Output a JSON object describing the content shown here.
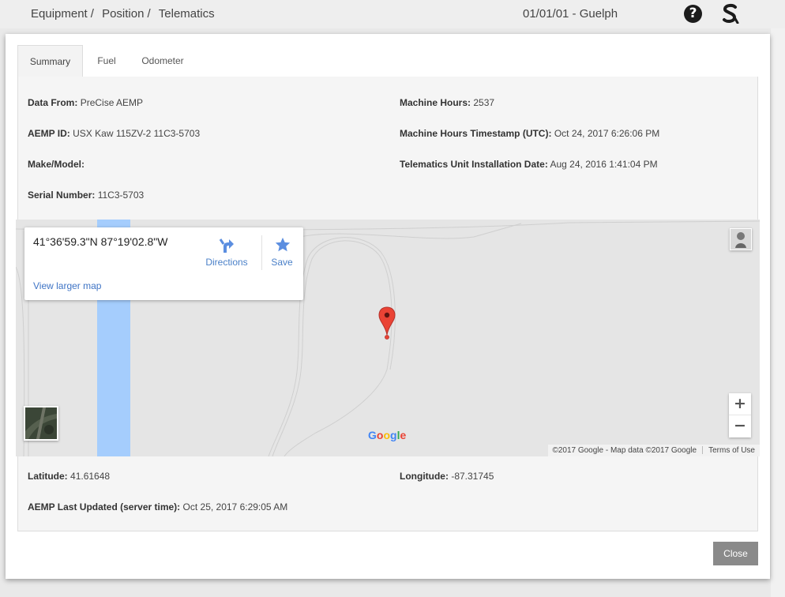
{
  "header": {
    "breadcrumbs": [
      "Equipment",
      "Position",
      "Telematics"
    ],
    "separator": "/",
    "location": "01/01/01 - Guelph",
    "help_icon": "?"
  },
  "tabs": [
    {
      "label": "Summary",
      "active": true
    },
    {
      "label": "Fuel",
      "active": false
    },
    {
      "label": "Odometer",
      "active": false
    }
  ],
  "summary": {
    "data_from_label": "Data From:",
    "data_from_value": "PreCise AEMP",
    "aemp_id_label": "AEMP ID:",
    "aemp_id_value": "USX Kaw 115ZV-2 11C3-5703",
    "make_model_label": "Make/Model:",
    "make_model_value": "",
    "serial_label": "Serial Number:",
    "serial_value": "11C3-5703",
    "machine_hours_label": "Machine Hours:",
    "machine_hours_value": "2537",
    "hours_timestamp_label": "Machine Hours Timestamp (UTC):",
    "hours_timestamp_value": "Oct 24, 2017 6:26:06 PM",
    "install_date_label": "Telematics Unit Installation Date:",
    "install_date_value": "Aug 24, 2016 1:41:04 PM",
    "latitude_label": "Latitude:",
    "latitude_value": "41.61648",
    "longitude_label": "Longitude:",
    "longitude_value": "-87.31745",
    "last_updated_label": "AEMP Last Updated (server time):",
    "last_updated_value": "Oct 25, 2017 6:29:05 AM"
  },
  "map": {
    "coords": "41°36'59.3\"N 87°19'02.8\"W",
    "directions_label": "Directions",
    "save_label": "Save",
    "view_larger": "View larger map",
    "zoom_in": "+",
    "zoom_out": "−",
    "google_logo": "Google",
    "attribution": "©2017 Google - Map data ©2017 Google",
    "terms": "Terms of Use",
    "colors": {
      "water": "#a5cdfd",
      "marker": "#ea4335",
      "link": "#3f74c5"
    }
  },
  "footer": {
    "close_label": "Close"
  }
}
